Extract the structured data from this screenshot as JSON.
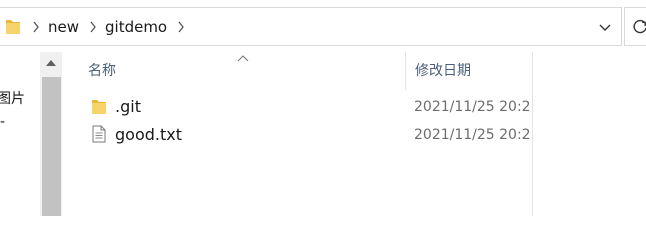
{
  "address_bar": {
    "breadcrumbs": [
      {
        "label": "new"
      },
      {
        "label": "gitdemo"
      }
    ]
  },
  "left_pane": {
    "partial_text_1": "图片",
    "partial_text_2": "-"
  },
  "file_list": {
    "columns": {
      "name": "名称",
      "date_modified": "修改日期"
    },
    "rows": [
      {
        "name": ".git",
        "date_modified": "2021/11/25 20:2",
        "icon": "folder-icon"
      },
      {
        "name": "good.txt",
        "date_modified": "2021/11/25 20:2",
        "icon": "text-file-icon"
      }
    ]
  },
  "colors": {
    "folder": "#f0c94a",
    "header_text": "#4c607a"
  }
}
